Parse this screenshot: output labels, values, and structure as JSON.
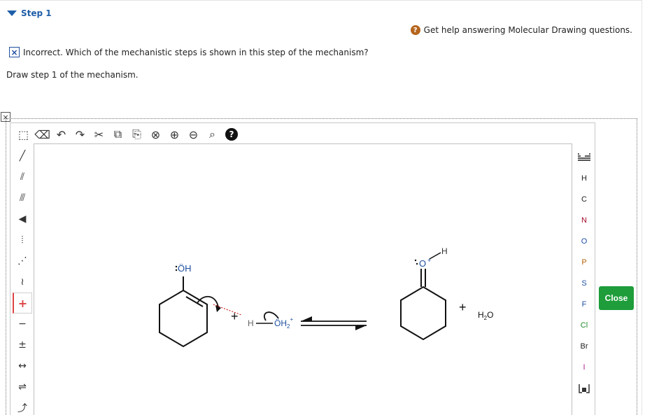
{
  "step": {
    "title": "Step 1"
  },
  "help": {
    "icon": "?",
    "text": "Get help answering Molecular Drawing questions."
  },
  "status": {
    "mark": "×",
    "text": "Incorrect. Which of the mechanistic steps is shown in this step of the mechanism?"
  },
  "instruction": "Draw step 1 of the mechanism.",
  "editor": {
    "corner_close": "×",
    "top_tools": [
      {
        "name": "lasso-select-icon",
        "glyph": "⬚"
      },
      {
        "name": "eraser-icon",
        "glyph": "⌫"
      },
      {
        "name": "undo-icon",
        "glyph": "↶"
      },
      {
        "name": "redo-icon",
        "glyph": "↷"
      },
      {
        "name": "cut-icon",
        "glyph": "✂"
      },
      {
        "name": "copy-icon",
        "glyph": "⧉"
      },
      {
        "name": "paste-icon",
        "glyph": "⎘"
      },
      {
        "name": "clear-icon",
        "glyph": "⊗"
      },
      {
        "name": "zoom-in-icon",
        "glyph": "⊕"
      },
      {
        "name": "zoom-out-icon",
        "glyph": "⊖"
      },
      {
        "name": "zoom-fit-icon",
        "glyph": "⌕"
      }
    ],
    "help_glyph": "?",
    "left_tools": [
      {
        "name": "single-bond-icon",
        "glyph": "╱"
      },
      {
        "name": "double-bond-icon",
        "glyph": "⫽"
      },
      {
        "name": "triple-bond-icon",
        "glyph": "⫻"
      },
      {
        "name": "wedge-bond-icon",
        "glyph": "◀"
      },
      {
        "name": "hash-bond-icon",
        "glyph": "⦙"
      },
      {
        "name": "wavy-bond-icon",
        "glyph": "⋰"
      },
      {
        "name": "chain-icon",
        "glyph": "≀"
      },
      {
        "name": "positive-charge-icon",
        "glyph": "+",
        "active": true
      },
      {
        "name": "negative-charge-icon",
        "glyph": "−"
      },
      {
        "name": "radical-icon",
        "glyph": "±"
      },
      {
        "name": "lone-pair-icon",
        "glyph": "↔"
      },
      {
        "name": "equilibrium-icon",
        "glyph": "⇌"
      },
      {
        "name": "curved-arrow-icon",
        "glyph": "⤴"
      }
    ],
    "elements": [
      "H",
      "C",
      "N",
      "O",
      "P",
      "S",
      "F",
      "Cl",
      "Br",
      "I"
    ],
    "element_colors": {
      "H": "#222222",
      "C": "#222222",
      "N": "#a10a2a",
      "O": "#1f4fa0",
      "P": "#b45f06",
      "S": "#1f4fa0",
      "F": "#1f4fa0",
      "Cl": "#1f8a2a",
      "Br": "#222222",
      "I": "#b01e8f"
    },
    "periodic_table_icon": "periodic-table-icon",
    "template_icon": "template-icon",
    "close_label": "Close"
  },
  "drawing": {
    "reactant_oh": "ÖH",
    "plus_1": "+",
    "acid_h": "H",
    "acid_oh2": "ÖH",
    "acid_sub": "2",
    "acid_sup": "+",
    "product_o": "O",
    "product_o_charge": "+",
    "product_h": "H",
    "plus_2": "+",
    "water": "H",
    "water_sub": "2",
    "water_o": "O"
  }
}
